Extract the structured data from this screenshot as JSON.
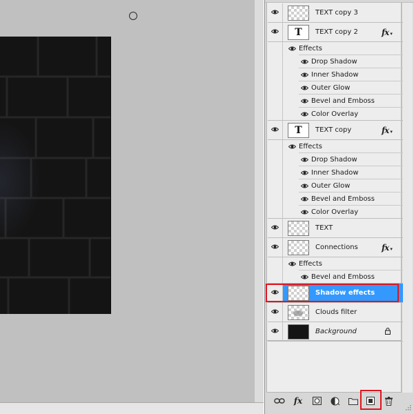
{
  "layers_panel": {
    "layers": [
      {
        "name": "TEXT copy 3",
        "thumbnail": "transparent-icon",
        "visible": true,
        "has_fx": false
      },
      {
        "name": "TEXT copy 2",
        "thumbnail": "text-layer-icon",
        "thumb_glyph": "T",
        "visible": true,
        "has_fx": true,
        "effects_label": "Effects",
        "effects": [
          "Drop Shadow",
          "Inner Shadow",
          "Outer Glow",
          "Bevel and Emboss",
          "Color Overlay"
        ]
      },
      {
        "name": "TEXT copy",
        "thumbnail": "text-layer-icon",
        "thumb_glyph": "T",
        "visible": true,
        "has_fx": true,
        "effects_label": "Effects",
        "effects": [
          "Drop Shadow",
          "Inner Shadow",
          "Outer Glow",
          "Bevel and Emboss",
          "Color Overlay"
        ]
      },
      {
        "name": "TEXT",
        "thumbnail": "transparent-icon",
        "visible": true,
        "has_fx": false
      },
      {
        "name": "Connections",
        "thumbnail": "transparent-icon",
        "visible": true,
        "has_fx": true,
        "effects_label": "Effects",
        "effects": [
          "Bevel and Emboss"
        ]
      },
      {
        "name": "Shadow effects",
        "thumbnail": "transparent-icon",
        "visible": true,
        "has_fx": false,
        "selected": true
      },
      {
        "name": "Clouds filter",
        "thumbnail": "transparent-icon",
        "visible": true,
        "has_fx": false
      },
      {
        "name": "Background",
        "thumbnail": "dark-image-icon",
        "visible": true,
        "has_fx": false,
        "locked": true
      }
    ],
    "fx_badge": "fx",
    "toolbar": [
      {
        "name": "link-layers-icon"
      },
      {
        "name": "add-layer-style-icon",
        "label": "fx"
      },
      {
        "name": "add-layer-mask-icon"
      },
      {
        "name": "adjustment-layer-icon"
      },
      {
        "name": "new-group-icon"
      },
      {
        "name": "new-layer-icon",
        "highlighted": true
      },
      {
        "name": "delete-layer-icon"
      }
    ]
  },
  "colors": {
    "selection": "#3399ff",
    "highlight_box": "#e0141e",
    "canvas_background": "#c0c0c0",
    "panel_background": "#ededed"
  }
}
